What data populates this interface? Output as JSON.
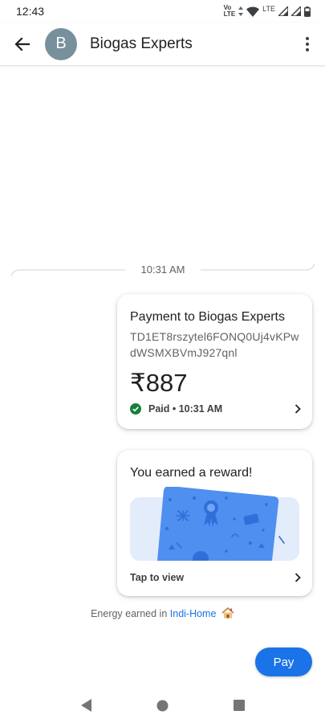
{
  "status_bar": {
    "time": "12:43",
    "volte_top": "Vo",
    "volte_bottom": "LTE",
    "lte": "LTE",
    "icons": [
      "arrows-icon",
      "wifi-icon",
      "signal-icon",
      "signal-icon",
      "battery-icon"
    ]
  },
  "header": {
    "avatar_letter": "B",
    "contact_name": "Biogas Experts",
    "avatar_color": "#78909c"
  },
  "chat": {
    "timestamp": "10:31 AM",
    "payment": {
      "title": "Payment to Biogas Experts",
      "transaction_id": "TD1ET8rszytel6FONQ0Uj4vKPwdWSMXBVmJ927qnl",
      "amount": "₹887",
      "status": "Paid • 10:31 AM",
      "status_color": "#188038"
    },
    "reward": {
      "title": "You earned a reward!",
      "action": "Tap to view"
    },
    "energy_note": {
      "prefix": "Energy earned in ",
      "link": "Indi-Home"
    }
  },
  "pay_button": {
    "label": "Pay",
    "color": "#1a73e8"
  },
  "nav": {
    "back": "back-icon",
    "home": "home-icon",
    "recents": "recents-icon"
  }
}
